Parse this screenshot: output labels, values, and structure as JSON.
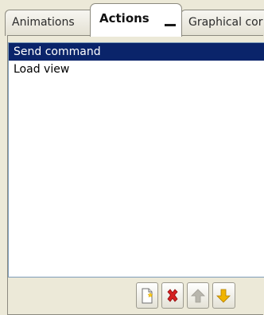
{
  "tabs": [
    {
      "label": "Animations",
      "active": false
    },
    {
      "label": "Actions",
      "active": true
    },
    {
      "label": "Graphical cor",
      "active": false
    }
  ],
  "actions_list": {
    "items": [
      {
        "label": "Send command",
        "selected": true
      },
      {
        "label": "Load view",
        "selected": false
      }
    ]
  },
  "toolbar": {
    "buttons": [
      {
        "icon": "new-document-icon"
      },
      {
        "icon": "delete-icon"
      },
      {
        "icon": "arrow-up-icon",
        "enabled": false
      },
      {
        "icon": "arrow-down-icon",
        "enabled": true
      }
    ]
  },
  "colors": {
    "selection": "#0a246a",
    "delete": "#d62020",
    "down_arrow": "#f0b400",
    "disabled_arrow": "#b8b6ad"
  }
}
